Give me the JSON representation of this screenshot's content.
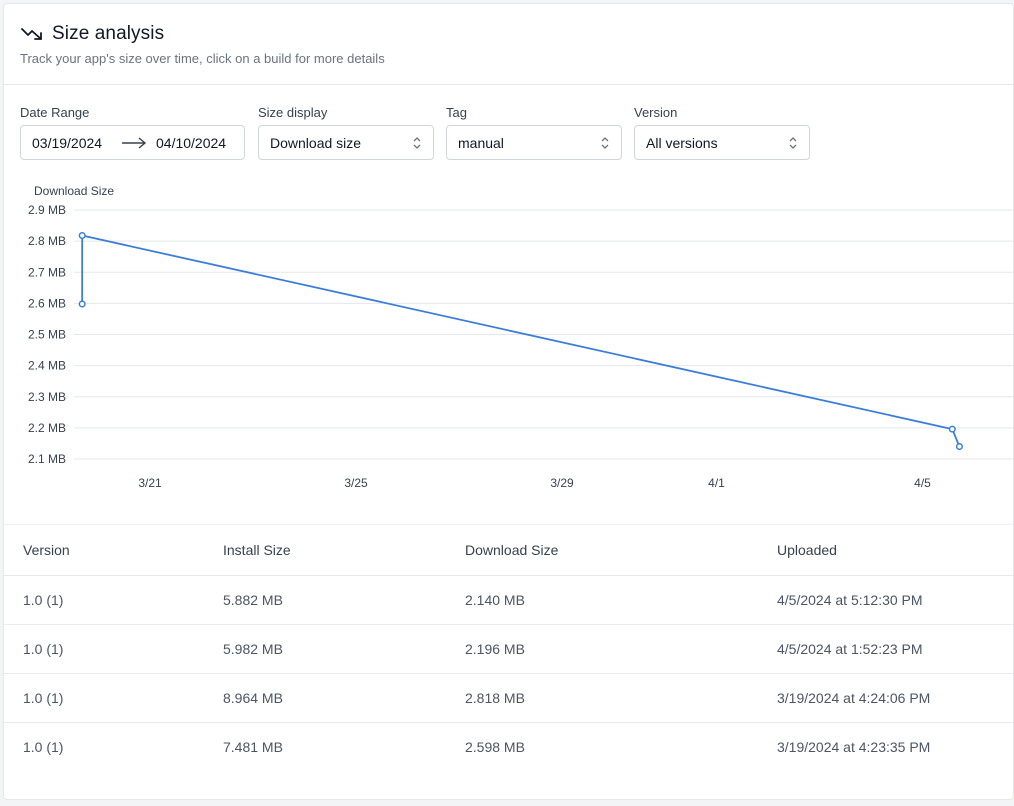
{
  "header": {
    "title": "Size analysis",
    "subtitle": "Track your app's size over time, click on a build for more details",
    "icon": "trending-down-icon"
  },
  "filters": {
    "date_range": {
      "label": "Date Range",
      "start": "03/19/2024",
      "end": "04/10/2024"
    },
    "size_display": {
      "label": "Size display",
      "value": "Download size"
    },
    "tag": {
      "label": "Tag",
      "value": "manual"
    },
    "version": {
      "label": "Version",
      "value": "All versions"
    }
  },
  "chart_data": {
    "type": "line",
    "title": "",
    "ylabel": "Download Size",
    "xlabel": "",
    "ylim": [
      2.1,
      2.9
    ],
    "y_ticks": [
      "2.9 MB",
      "2.8 MB",
      "2.7 MB",
      "2.6 MB",
      "2.5 MB",
      "2.4 MB",
      "2.3 MB",
      "2.2 MB",
      "2.1 MB"
    ],
    "y_tick_values": [
      2.9,
      2.8,
      2.7,
      2.6,
      2.5,
      2.4,
      2.3,
      2.2,
      2.1
    ],
    "x_ticks": [
      "3/21",
      "3/25",
      "3/29",
      "4/1",
      "4/5"
    ],
    "x_tick_dates": [
      "2024-03-21",
      "2024-03-25",
      "2024-03-29",
      "2024-04-01",
      "2024-04-05"
    ],
    "grid": true,
    "color": "#3b7dd8",
    "series": [
      {
        "points": [
          {
            "x": "2024-03-19T16:23:35",
            "y": 2.598
          },
          {
            "x": "2024-03-19T16:24:06",
            "y": 2.818
          },
          {
            "x": "2024-04-05T13:52:23",
            "y": 2.196
          },
          {
            "x": "2024-04-05T17:12:30",
            "y": 2.14
          }
        ]
      }
    ]
  },
  "table": {
    "columns": [
      "Version",
      "Install Size",
      "Download Size",
      "Uploaded"
    ],
    "rows": [
      [
        "1.0 (1)",
        "5.882 MB",
        "2.140 MB",
        "4/5/2024 at 5:12:30 PM"
      ],
      [
        "1.0 (1)",
        "5.982 MB",
        "2.196 MB",
        "4/5/2024 at 1:52:23 PM"
      ],
      [
        "1.0 (1)",
        "8.964 MB",
        "2.818 MB",
        "3/19/2024 at 4:24:06 PM"
      ],
      [
        "1.0 (1)",
        "7.481 MB",
        "2.598 MB",
        "3/19/2024 at 4:23:35 PM"
      ]
    ]
  }
}
